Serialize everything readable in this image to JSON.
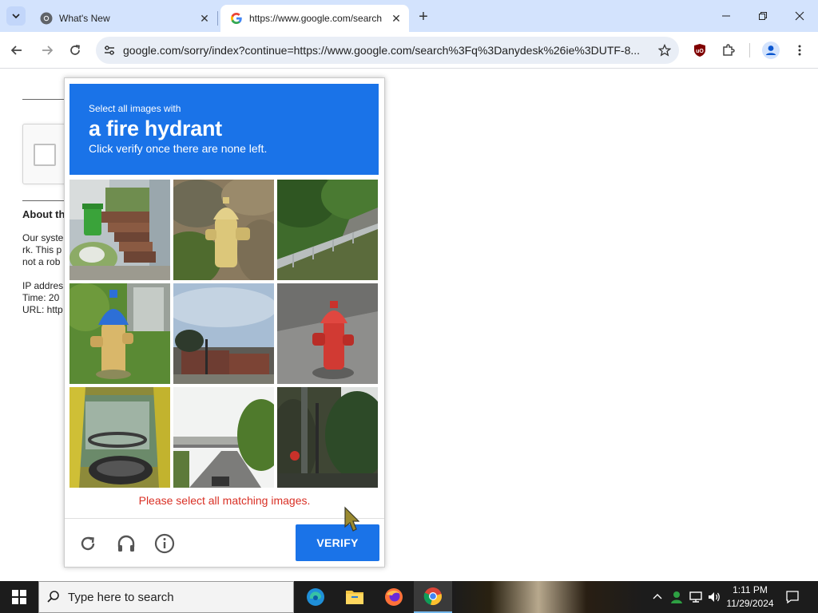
{
  "browser": {
    "tabs": [
      {
        "title": "What's New",
        "icon": "chrome-icon",
        "active": false
      },
      {
        "title": "https://www.google.com/search",
        "icon": "google-icon",
        "active": true
      }
    ],
    "url": "google.com/sorry/index?continue=https://www.google.com/search%3Fq%3Danydesk%26ie%3DUTF-8..."
  },
  "page": {
    "about_heading": "About th",
    "para_lines": [
      "Our syste",
      "rk. This p",
      "not a rob"
    ],
    "info_lines": [
      "IP addres",
      "Time: 20",
      "URL: http"
    ]
  },
  "captcha": {
    "instruction_line1": "Select all images with",
    "target": "a fire hydrant",
    "instruction_line3": "Click verify once there are none left.",
    "error": "Please select all matching images.",
    "verify_label": "VERIFY",
    "accent_color": "#1a73e8",
    "error_color": "#d93025"
  },
  "taskbar": {
    "search_placeholder": "Type here to search",
    "time": "1:11 PM",
    "date": "11/29/2024"
  }
}
